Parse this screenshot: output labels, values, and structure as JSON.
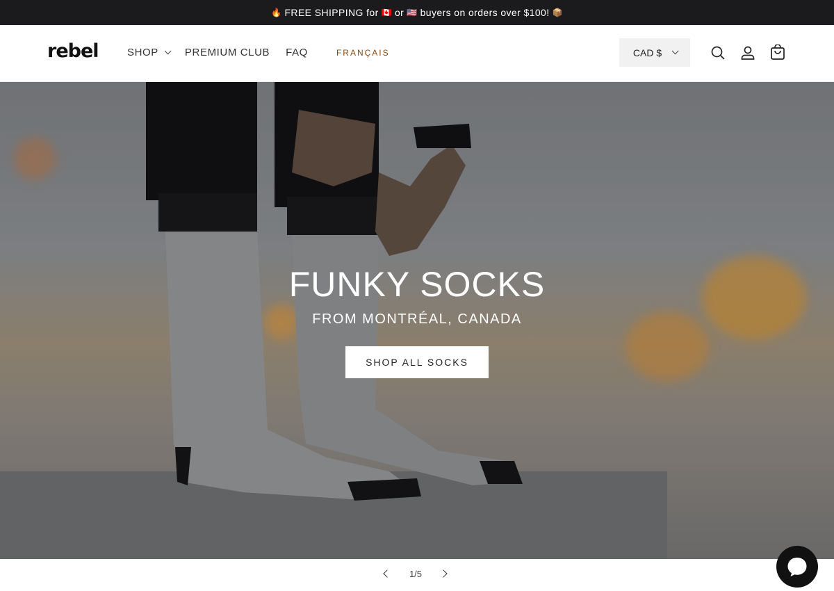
{
  "announcement": {
    "prefix_emoji": "🔥",
    "text_part1": "FREE SHIPPING for",
    "flag_ca": "🇨🇦",
    "text_or": "or",
    "flag_us": "🇺🇸",
    "text_part2": "buyers on orders over $100!",
    "suffix_emoji": "📦"
  },
  "header": {
    "logo": "rebel",
    "nav": {
      "shop": "SHOP",
      "premium": "PREMIUM CLUB",
      "faq": "FAQ",
      "language": "FRANÇAIS"
    },
    "currency": "CAD $",
    "icons": [
      "search-icon",
      "account-icon",
      "cart-icon"
    ]
  },
  "hero": {
    "title": "FUNKY SOCKS",
    "subtitle": "FROM MONTRÉAL, CANADA",
    "button": "SHOP ALL SOCKS"
  },
  "slider": {
    "counter": "1/5"
  },
  "colors": {
    "announcement_bg": "#1b1b1d",
    "language_link": "#8a4b16",
    "chat_bg": "#111111"
  }
}
